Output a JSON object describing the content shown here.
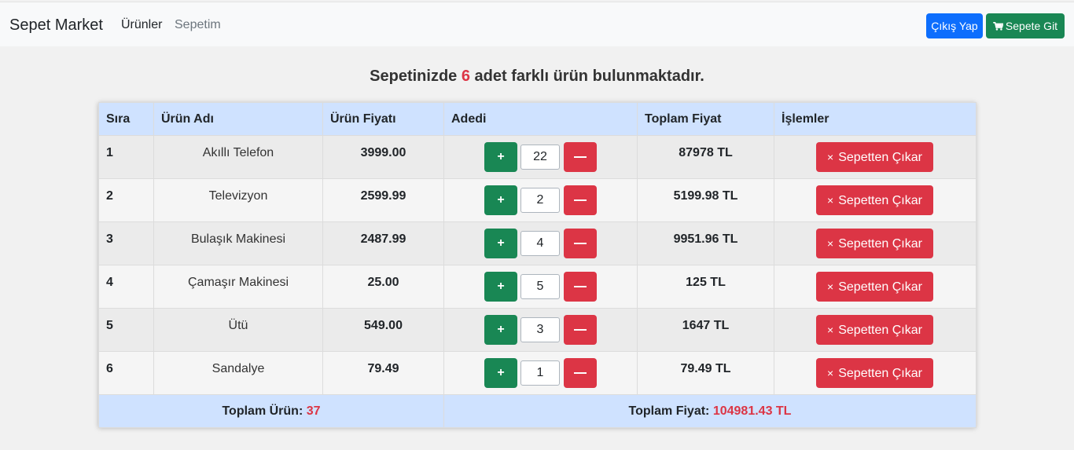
{
  "navbar": {
    "brand": "Sepet Market",
    "links": [
      "Ürünler",
      "Sepetim"
    ],
    "logout_label": "Çıkış Yap",
    "cart_label": "Sepete Git"
  },
  "headline": {
    "prefix": "Sepetinizde",
    "count": "6",
    "suffix": "adet farklı ürün bulunmaktadır."
  },
  "table": {
    "headers": [
      "Sıra",
      "Ürün Adı",
      "Ürün Fiyatı",
      "Adedi",
      "Toplam Fiyat",
      "İşlemler"
    ],
    "rows": [
      {
        "sira": "1",
        "name": "Akıllı Telefon",
        "price": "3999.00",
        "qty": "22",
        "total": "87978 TL"
      },
      {
        "sira": "2",
        "name": "Televizyon",
        "price": "2599.99",
        "qty": "2",
        "total": "5199.98 TL"
      },
      {
        "sira": "3",
        "name": "Bulaşık Makinesi",
        "price": "2487.99",
        "qty": "4",
        "total": "9951.96 TL"
      },
      {
        "sira": "4",
        "name": "Çamaşır Makinesi",
        "price": "25.00",
        "qty": "5",
        "total": "125 TL"
      },
      {
        "sira": "5",
        "name": "Ütü",
        "price": "549.00",
        "qty": "3",
        "total": "1647 TL"
      },
      {
        "sira": "6",
        "name": "Sandalye",
        "price": "79.49",
        "qty": "1",
        "total": "79.49 TL"
      }
    ],
    "plus_label": "+",
    "remove_label": "Sepetten Çıkar",
    "remove_icon": "×",
    "footer": {
      "total_items_label": "Toplam Ürün:",
      "total_items_value": "37",
      "total_price_label": "Toplam Fiyat:",
      "total_price_value": "104981.43 TL"
    }
  },
  "colors": {
    "primary": "#0d6efd",
    "success": "#198754",
    "danger": "#dc3545",
    "header_bg": "#cfe2ff"
  }
}
